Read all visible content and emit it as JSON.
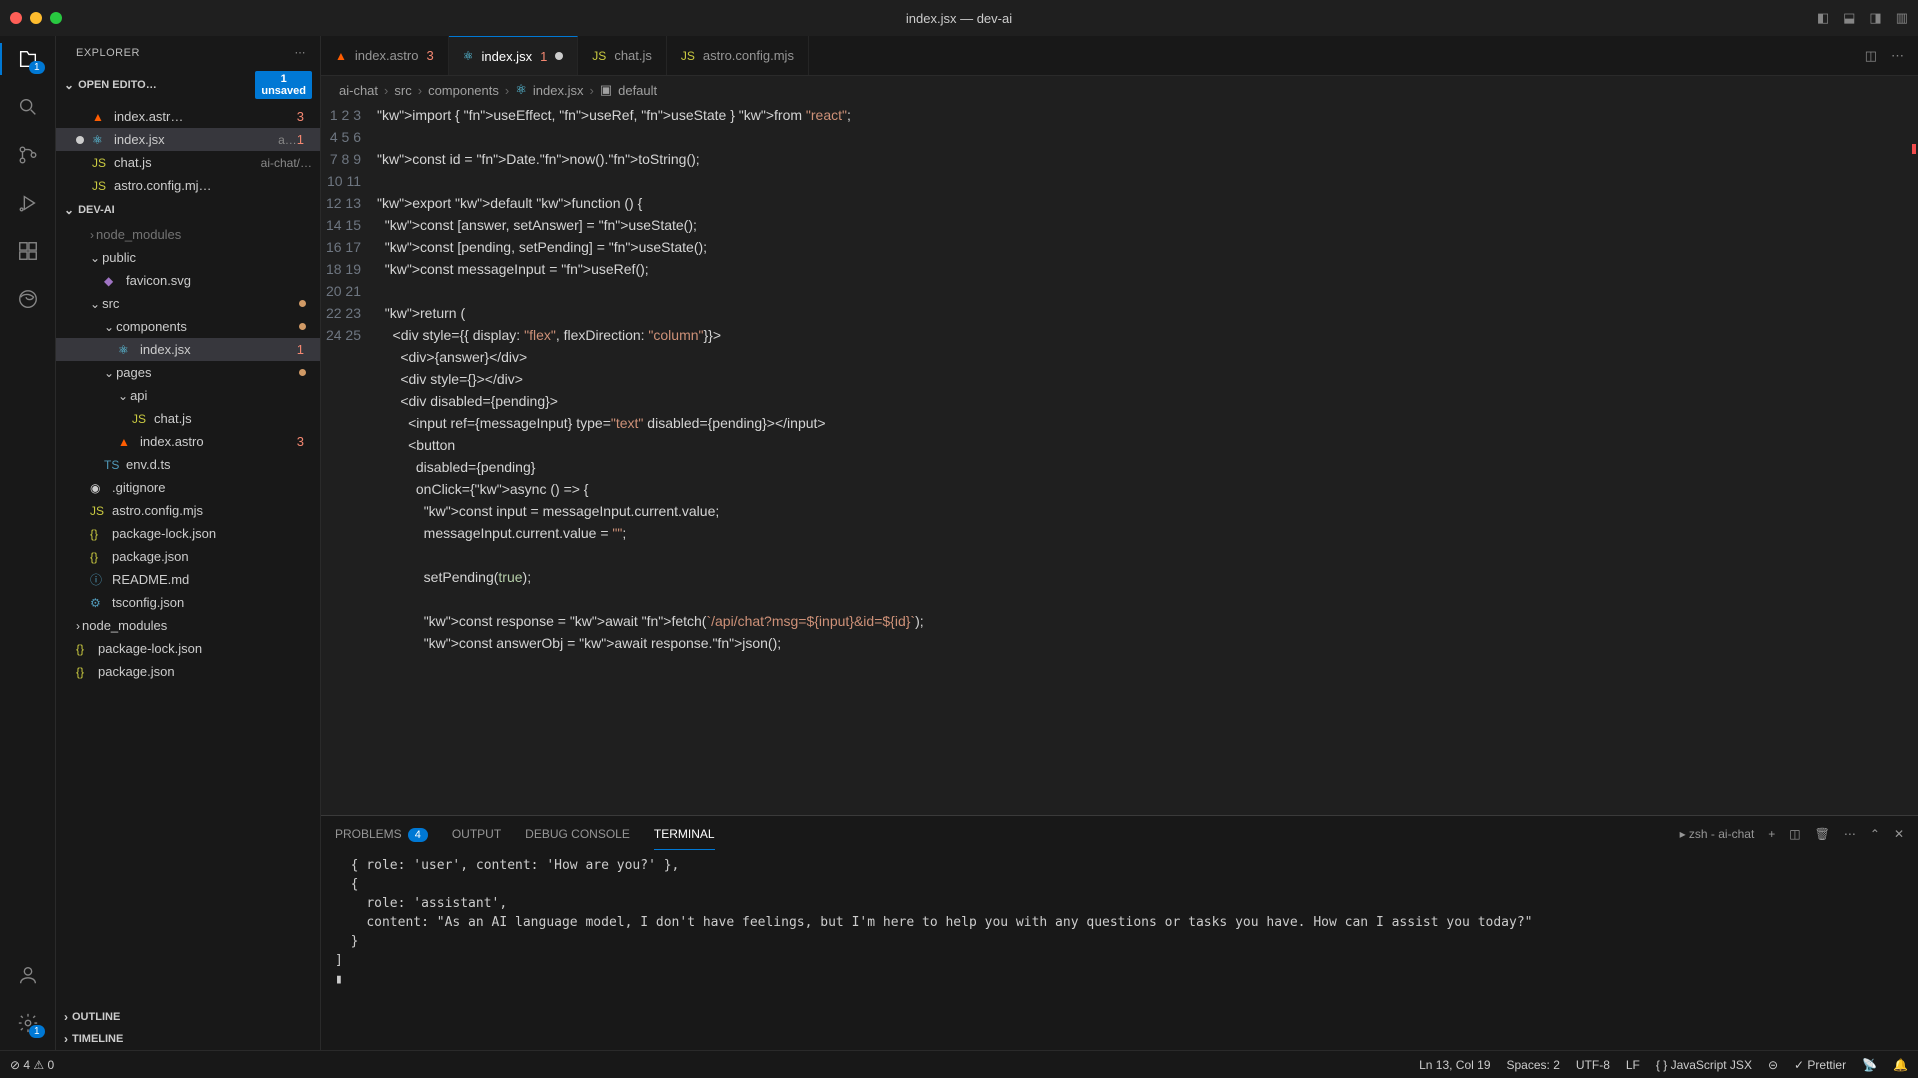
{
  "titlebar": {
    "title": "index.jsx — dev-ai"
  },
  "explorer": {
    "title": "EXPLORER"
  },
  "sections": {
    "openEditors": {
      "label": "OPEN EDITO…",
      "unsaved_count": "1",
      "unsaved_label": "unsaved"
    },
    "project": {
      "label": "DEV-AI"
    },
    "outline": {
      "label": "OUTLINE"
    },
    "timeline": {
      "label": "TIMELINE"
    }
  },
  "openEditors": [
    {
      "name": "index.astr…",
      "badge": "3",
      "icon": "astro",
      "modified": false
    },
    {
      "name": "index.jsx",
      "sub": "a…",
      "badge": "1",
      "icon": "react",
      "modified": true
    },
    {
      "name": "chat.js",
      "sub": "ai-chat/…",
      "icon": "js",
      "modified": false
    },
    {
      "name": "astro.config.mj…",
      "icon": "js",
      "modified": false
    }
  ],
  "tree": {
    "nodeModulesGhost": "node_modules",
    "folders": {
      "public": "public",
      "favicon": "favicon.svg",
      "src": "src",
      "components": "components",
      "indexjsx": "index.jsx",
      "indexjsx_badge": "1",
      "pages": "pages",
      "api": "api",
      "chatjs": "chat.js",
      "indexastro": "index.astro",
      "indexastro_badge": "3",
      "envdts": "env.d.ts",
      "gitignore": ".gitignore",
      "astroconfig": "astro.config.mjs",
      "packagelock": "package-lock.json",
      "packagejson": "package.json",
      "readme": "README.md",
      "tsconfig": "tsconfig.json",
      "nodeModules": "node_modules",
      "rootPackageLock": "package-lock.json",
      "rootPackageJson": "package.json"
    }
  },
  "tabs": [
    {
      "name": "index.astro",
      "badge": "3",
      "icon": "astro",
      "active": false
    },
    {
      "name": "index.jsx",
      "badge": "1",
      "icon": "react",
      "active": true,
      "modified": true
    },
    {
      "name": "chat.js",
      "icon": "js",
      "active": false
    },
    {
      "name": "astro.config.mjs",
      "icon": "js",
      "active": false
    }
  ],
  "breadcrumb": [
    "ai-chat",
    "src",
    "components",
    "index.jsx",
    "default"
  ],
  "code": {
    "lines": [
      "import { useEffect, useRef, useState } from \"react\";",
      "",
      "const id = Date.now().toString();",
      "",
      "export default function () {",
      "  const [answer, setAnswer] = useState();",
      "  const [pending, setPending] = useState();",
      "  const messageInput = useRef();",
      "",
      "  return (",
      "    <div style={{ display: \"flex\", flexDirection: \"column\"}}>",
      "      <div>{answer}</div>",
      "      <div style={}></div>",
      "      <div disabled={pending}>",
      "        <input ref={messageInput} type=\"text\" disabled={pending}></input>",
      "        <button",
      "          disabled={pending}",
      "          onClick={async () => {",
      "            const input = messageInput.current.value;",
      "            messageInput.current.value = \"\";",
      "",
      "            setPending(true);",
      "",
      "            const response = await fetch(`/api/chat?msg=${input}&id=${id}`);",
      "            const answerObj = await response.json();"
    ]
  },
  "panel": {
    "tabs": {
      "problems": "PROBLEMS",
      "problems_count": "4",
      "output": "OUTPUT",
      "debug": "DEBUG CONSOLE",
      "terminal": "TERMINAL"
    },
    "terminal_label": "zsh - ai-chat",
    "body": "  { role: 'user', content: 'How are you?' },\n  {\n    role: 'assistant',\n    content: \"As an AI language model, I don't have feelings, but I'm here to help you with any questions or tasks you have. How can I assist you today?\"\n  }\n]\n▮"
  },
  "statusbar": {
    "errors": "4",
    "warnings": "0",
    "pos": "Ln 13, Col 19",
    "spaces": "Spaces: 2",
    "encoding": "UTF-8",
    "eol": "LF",
    "lang": "JavaScript JSX",
    "prettier": "Prettier"
  }
}
